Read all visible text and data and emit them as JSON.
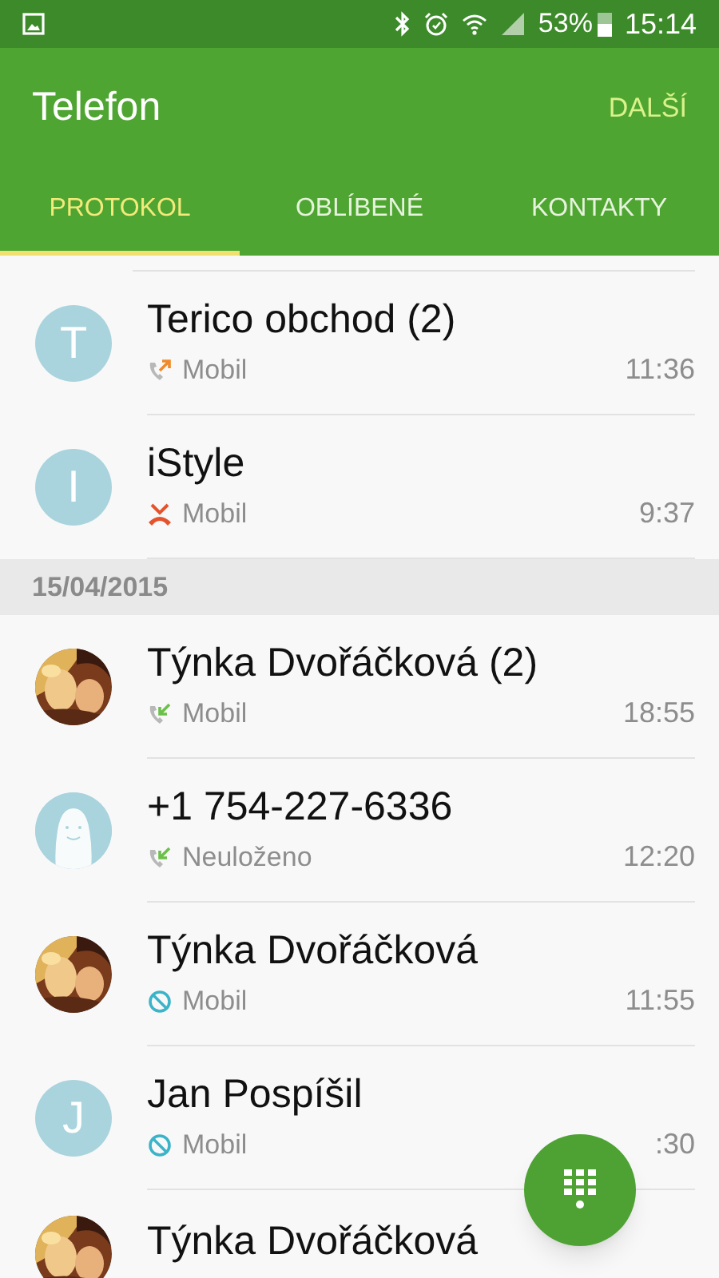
{
  "status_bar": {
    "battery": "53%",
    "time": "15:14"
  },
  "app_bar": {
    "title": "Telefon",
    "action": "DALŠÍ"
  },
  "tabs": [
    {
      "label": "PROTOKOL",
      "selected": true
    },
    {
      "label": "OBLÍBENÉ",
      "selected": false
    },
    {
      "label": "KONTAKTY",
      "selected": false
    }
  ],
  "log": [
    {
      "kind": "call",
      "name": "Terico obchod (2)",
      "avatar": {
        "kind": "letter",
        "letter": "T"
      },
      "call": {
        "kind": "outgoing"
      },
      "label": "Mobil",
      "time": "11:36"
    },
    {
      "kind": "call",
      "name": "iStyle",
      "avatar": {
        "kind": "letter",
        "letter": "I"
      },
      "call": {
        "kind": "missed"
      },
      "label": "Mobil",
      "time": "9:37"
    },
    {
      "kind": "date",
      "label": "15/04/2015"
    },
    {
      "kind": "call",
      "name": "Týnka Dvořáčková (2)",
      "call": {
        "kind": "incoming"
      },
      "label": "Mobil",
      "time": "18:55"
    },
    {
      "kind": "call",
      "name": "+1 754-227-6336",
      "avatar": {
        "kind": "placeholder"
      },
      "call": {
        "kind": "incoming"
      },
      "label": "Neuloženo",
      "time": "12:20"
    },
    {
      "kind": "call",
      "name": "Týnka Dvořáčková",
      "call": {
        "kind": "rejected"
      },
      "label": "Mobil",
      "time": "11:55"
    },
    {
      "kind": "call",
      "name": "Jan Pospíšil",
      "avatar": {
        "kind": "letter",
        "letter": "J"
      },
      "call": {
        "kind": "rejected"
      },
      "label": "Mobil",
      "time": ":30"
    },
    {
      "kind": "call",
      "name": "Týnka Dvořáčková"
    }
  ]
}
